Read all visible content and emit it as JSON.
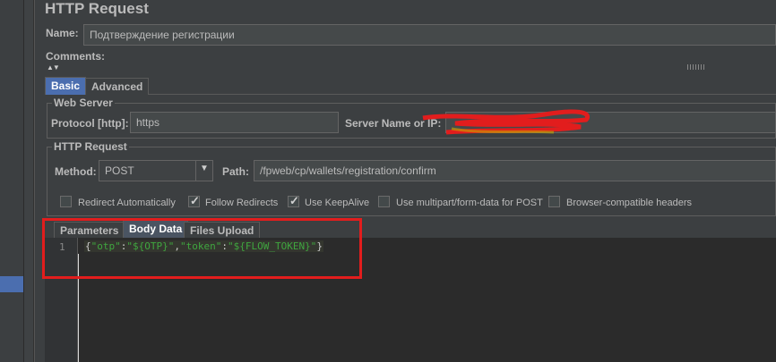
{
  "panel_title": "HTTP Request",
  "name_label": "Name:",
  "name_value": "Подтверждение регистрации",
  "comments_label": "Comments:",
  "tabs": [
    {
      "label": "Basic"
    },
    {
      "label": "Advanced"
    }
  ],
  "web_server": {
    "group_label": "Web Server",
    "protocol_label": "Protocol [http]:",
    "protocol_value": "https",
    "server_label": "Server Name or IP:"
  },
  "http_request": {
    "group_label": "HTTP Request",
    "method_label": "Method:",
    "method_value": "POST",
    "path_label": "Path:",
    "path_value": "/fpweb/cp/wallets/registration/confirm"
  },
  "options": [
    {
      "label": "Redirect Automatically",
      "checked": false
    },
    {
      "label": "Follow Redirects",
      "checked": true
    },
    {
      "label": "Use KeepAlive",
      "checked": true
    },
    {
      "label": "Use multipart/form-data for POST",
      "checked": false
    },
    {
      "label": "Browser-compatible headers",
      "checked": false
    }
  ],
  "body_tabs": [
    {
      "label": "Parameters"
    },
    {
      "label": "Body Data"
    },
    {
      "label": "Files Upload"
    }
  ],
  "editor": {
    "line_number": "1",
    "code_parts": [
      "{",
      "\"otp\"",
      ":",
      "\"${OTP}\"",
      ",",
      "\"token\"",
      ":",
      "\"${FLOW_TOKEN}\"",
      "}"
    ]
  },
  "colors": {
    "accent": "#4b6eaf",
    "annotation": "#e21d1d",
    "string": "#3fa63f"
  }
}
